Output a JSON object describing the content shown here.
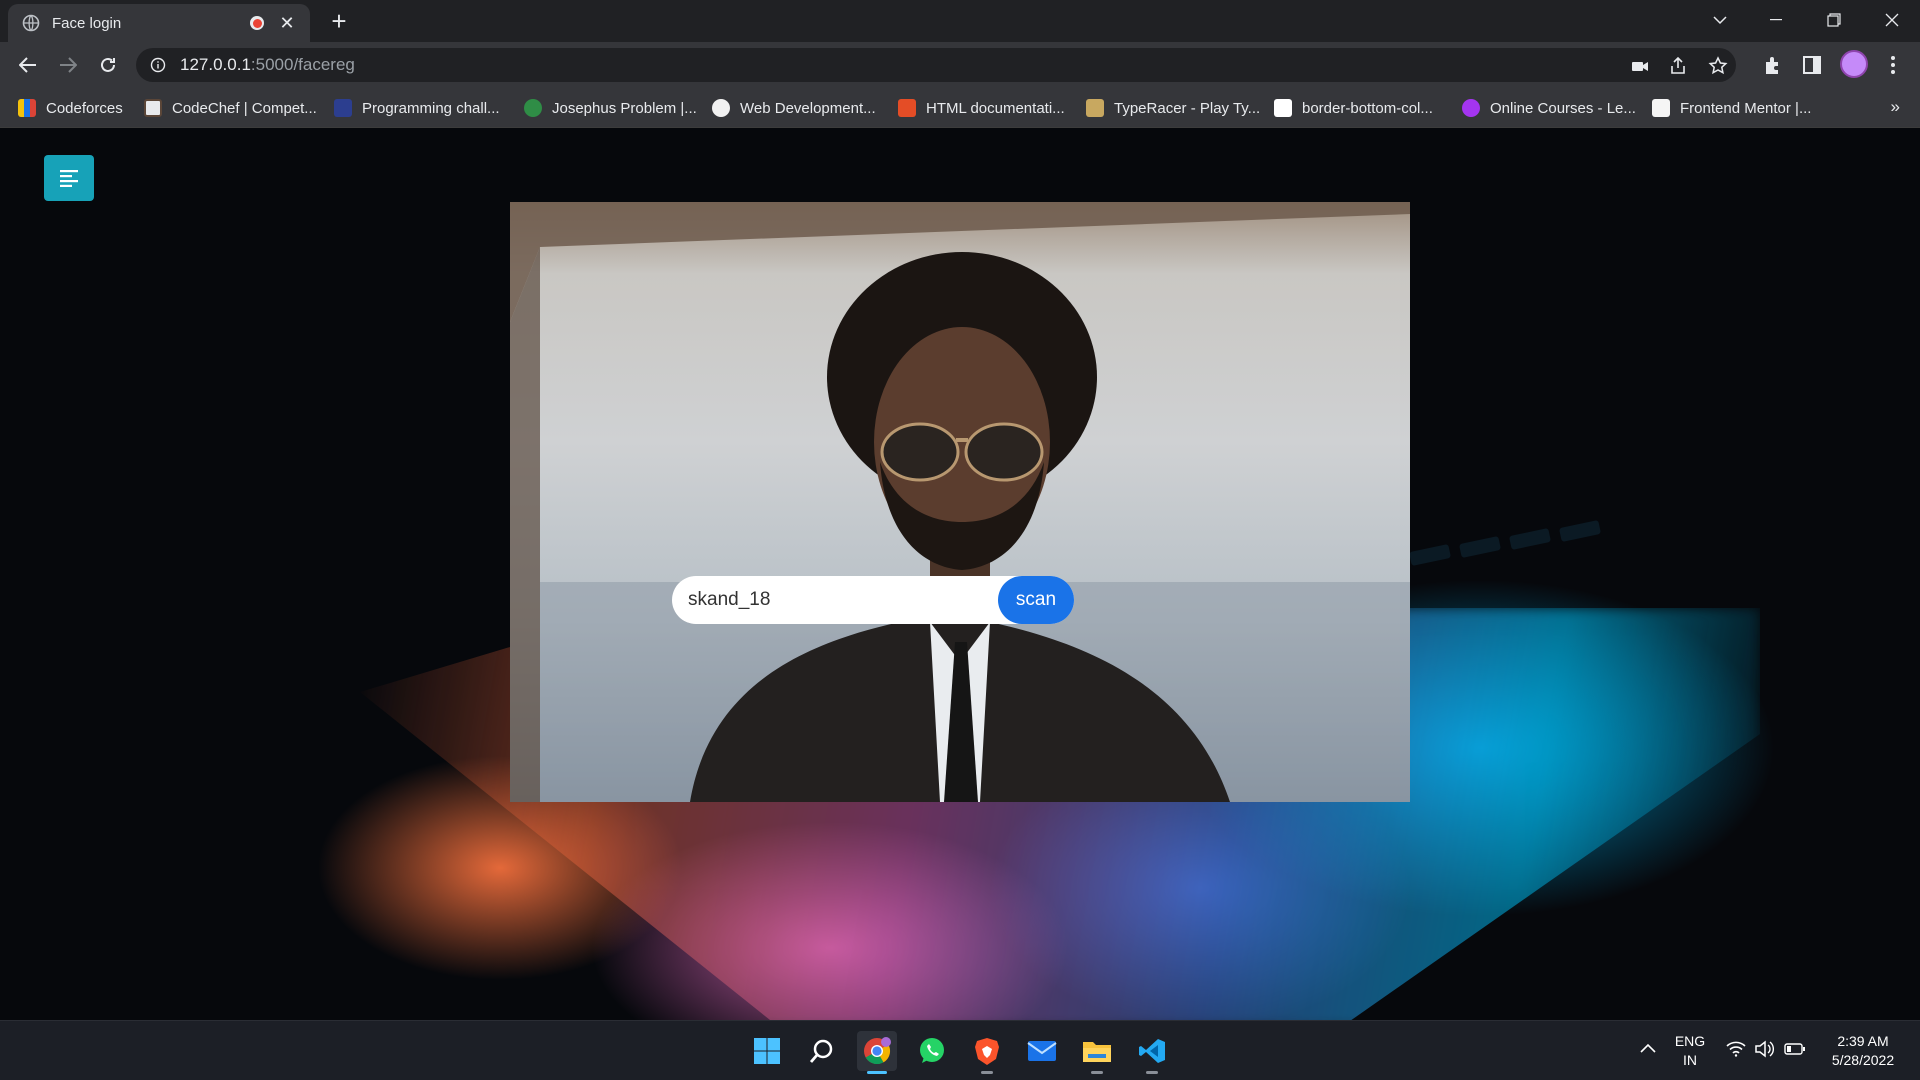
{
  "browser": {
    "tab_title": "Face login",
    "url_host": "127.0.0.1",
    "url_path": ":5000/facereg",
    "bookmarks": [
      "Codeforces",
      "CodeChef | Compet...",
      "Programming chall...",
      "Josephus Problem |...",
      "Web Development...",
      "HTML documentati...",
      "TypeRacer - Play Ty...",
      "border-bottom-col...",
      "Online Courses - Le...",
      "Frontend Mentor |..."
    ],
    "more_bookmarks": "»"
  },
  "page": {
    "username_value": "skand_18",
    "scan_label": "scan",
    "menu_button_color": "#17a2b8",
    "scan_button_color": "#1a73e8"
  },
  "taskbar": {
    "apps": [
      "start-icon",
      "search-icon",
      "chrome-icon",
      "whatsapp-icon",
      "brave-icon",
      "mail-icon",
      "file-explorer-icon",
      "vscode-icon"
    ],
    "language": "ENG",
    "region": "IN",
    "time": "2:39 AM",
    "date": "5/28/2022"
  }
}
